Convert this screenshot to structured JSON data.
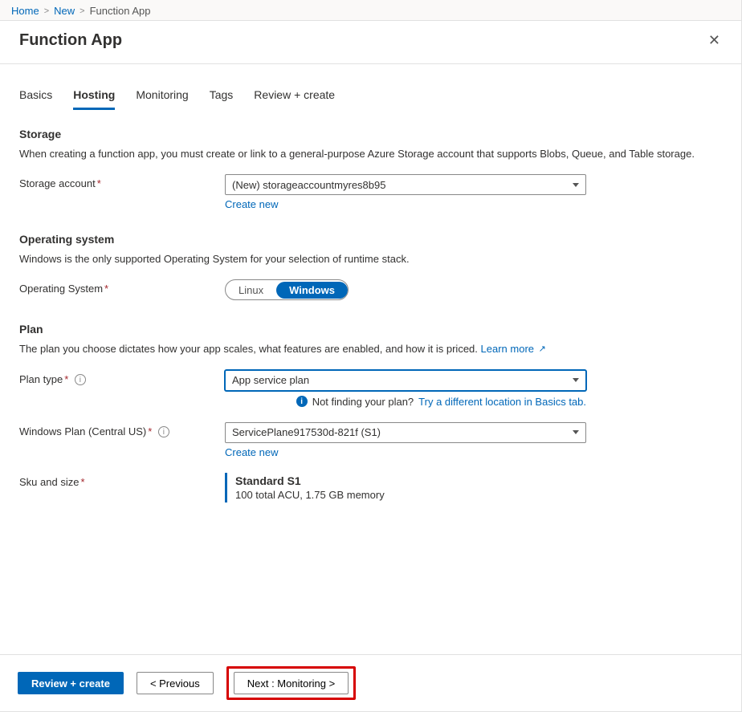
{
  "breadcrumbs": {
    "home": "Home",
    "new": "New",
    "current": "Function App"
  },
  "header": {
    "title": "Function App"
  },
  "tabs": {
    "basics": "Basics",
    "hosting": "Hosting",
    "monitoring": "Monitoring",
    "tags": "Tags",
    "review": "Review + create"
  },
  "storage": {
    "section_title": "Storage",
    "desc": "When creating a function app, you must create or link to a general-purpose Azure Storage account that supports Blobs, Queue, and Table storage.",
    "label": "Storage account",
    "value": "(New) storageaccountmyres8b95",
    "create_new": "Create new"
  },
  "os": {
    "section_title": "Operating system",
    "desc": "Windows is the only supported Operating System for your selection of runtime stack.",
    "label": "Operating System",
    "options": {
      "linux": "Linux",
      "windows": "Windows"
    }
  },
  "plan": {
    "section_title": "Plan",
    "desc": "The plan you choose dictates how your app scales, what features are enabled, and how it is priced.",
    "learn_more": "Learn more",
    "plan_type_label": "Plan type",
    "plan_type_value": "App service plan",
    "not_finding_text": "Not finding your plan?",
    "not_finding_link": "Try a different location in Basics tab.",
    "win_plan_label": "Windows Plan (Central US)",
    "win_plan_value": "ServicePlane917530d-821f (S1)",
    "create_new": "Create new",
    "sku_label": "Sku and size",
    "sku_title": "Standard S1",
    "sku_detail": "100 total ACU, 1.75 GB memory"
  },
  "footer": {
    "review": "Review + create",
    "previous": "< Previous",
    "next": "Next : Monitoring >"
  }
}
